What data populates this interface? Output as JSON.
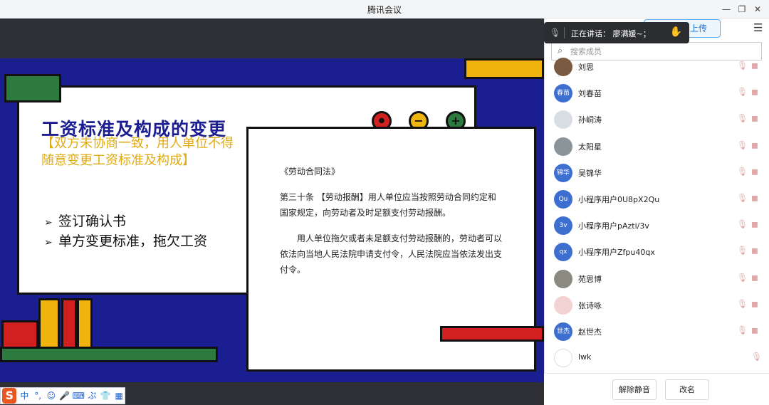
{
  "window": {
    "title": "腾讯会议",
    "minimize": "—",
    "restore": "❐",
    "close": "✕"
  },
  "slide": {
    "title": "工资标准及构成的变更",
    "subtitle": "【双方未协商一致，用人单位不得随意变更工资标准及构成】",
    "bullets": [
      "签订确认书",
      "单方变更标准，拖欠工资"
    ],
    "bullet_marker": "➢",
    "law_title": "《劳动合同法》",
    "law_p1": "第三十条 【劳动报酬】用人单位应当按照劳动合同约定和国家规定，向劳动者及时足额支付劳动报酬。",
    "law_p2": "用人单位拖欠或者未足额支付劳动报酬的，劳动者可以依法向当地人民法院申请支付令，人民法院应当依法发出支付令。",
    "colors": {
      "navy": "#1b1e90",
      "yellow": "#f0b40f",
      "red": "#d21f1f",
      "green": "#2d7a3e"
    }
  },
  "speaking": {
    "text": "正在讲话：  廖满媛~；",
    "mic_icon": "mic-muted-icon",
    "hand_icon": "hand-icon"
  },
  "panel": {
    "upload_label": "上传",
    "menu_icon": "hamburger-menu-icon",
    "search_placeholder": "搜索成员",
    "search_icon": "search-icon",
    "members": [
      {
        "name": "刘思",
        "avatar_text": "",
        "avatar_color": "#7a5a40",
        "muted": true,
        "cam_off": true
      },
      {
        "name": "刘春苗",
        "avatar_text": "春苗",
        "avatar_color": "#3d6fd0",
        "muted": true,
        "cam_off": true
      },
      {
        "name": "孙峒涛",
        "avatar_text": "",
        "avatar_color": "#d9dee4",
        "muted": true,
        "cam_off": true
      },
      {
        "name": "太阳星",
        "avatar_text": "",
        "avatar_color": "#8a9499",
        "muted": true,
        "cam_off": true
      },
      {
        "name": "吴锦华",
        "avatar_text": "锦华",
        "avatar_color": "#3d6fd0",
        "muted": true,
        "cam_off": true
      },
      {
        "name": "小程序用户0U8pX2Qu",
        "avatar_text": "Qu",
        "avatar_color": "#3d6fd0",
        "muted": true,
        "cam_off": true
      },
      {
        "name": "小程序用户pAzti/3v",
        "avatar_text": "3v",
        "avatar_color": "#3d6fd0",
        "muted": true,
        "cam_off": true
      },
      {
        "name": "小程序用户Zfpu40qx",
        "avatar_text": "qx",
        "avatar_color": "#3d6fd0",
        "muted": true,
        "cam_off": true
      },
      {
        "name": "苑思博",
        "avatar_text": "",
        "avatar_color": "#8b8a80",
        "muted": true,
        "cam_off": true
      },
      {
        "name": "张诗咏",
        "avatar_text": "",
        "avatar_color": "#f3d2d2",
        "muted": true,
        "cam_off": true
      },
      {
        "name": "赵世杰",
        "avatar_text": "世杰",
        "avatar_color": "#3d6fd0",
        "muted": true,
        "cam_off": true
      },
      {
        "name": "lwk",
        "avatar_text": "",
        "avatar_color": "#ffffff",
        "muted": true,
        "cam_off": false
      }
    ],
    "unmute_label": "解除静音",
    "rename_label": "改名"
  },
  "ime": {
    "logo": "S",
    "items": [
      "中",
      "°,",
      "☺",
      "🎤",
      "⌨",
      "ぷ",
      "👕",
      "▦"
    ]
  }
}
